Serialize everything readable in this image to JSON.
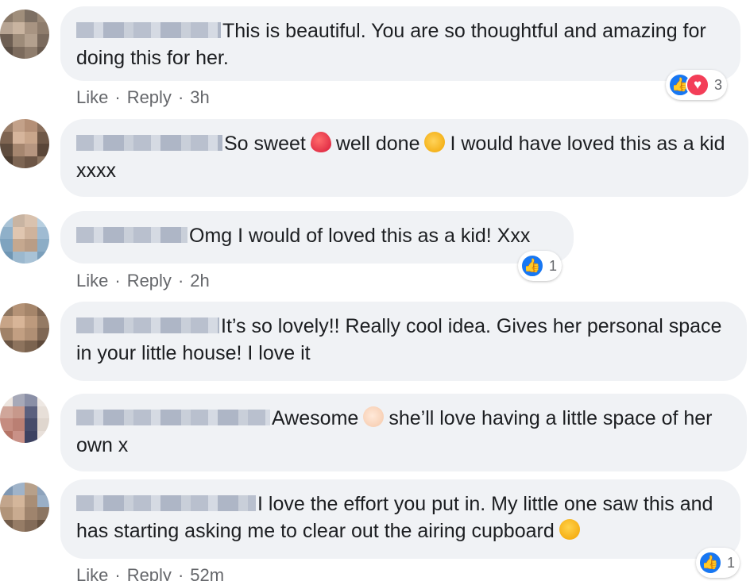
{
  "comments": [
    {
      "name_hidden": true,
      "text_parts": [
        "This is beautiful. You are so thoughtful and amazing for doing this for her."
      ],
      "actions": {
        "like": "Like",
        "reply": "Reply",
        "time": "3h"
      },
      "reactions": {
        "icons": [
          "like-icon",
          "love-icon"
        ],
        "count": "3"
      }
    },
    {
      "name_hidden": true,
      "text_parts": [
        "So sweet",
        "well done",
        "I would have loved this as a kid xxxx"
      ],
      "emojis": [
        "heart-emoji",
        "clapping-hands-emoji"
      ]
    },
    {
      "name_hidden": true,
      "text_parts": [
        "Omg I would of loved this as a kid! Xxx"
      ],
      "actions": {
        "like": "Like",
        "reply": "Reply",
        "time": "2h"
      },
      "reactions": {
        "icons": [
          "like-icon"
        ],
        "count": "1"
      }
    },
    {
      "name_hidden": true,
      "text_parts": [
        "It’s so lovely!! Really cool idea. Gives her personal space in your little house! I love it"
      ]
    },
    {
      "name_hidden": true,
      "text_parts": [
        "Awesome",
        "she’ll love having a little space of her own x"
      ],
      "emojis": [
        "clapping-hands-emoji"
      ]
    },
    {
      "name_hidden": true,
      "text_parts": [
        "I love the effort you put in. My little one saw this and has starting asking me to clear out the airing cupboard"
      ],
      "emojis": [
        "laughing-emoji"
      ],
      "actions": {
        "like": "Like",
        "reply": "Reply",
        "time": "52m"
      },
      "reactions": {
        "icons": [
          "like-icon"
        ],
        "count": "1"
      }
    }
  ],
  "separator": "·",
  "colors": {
    "bubble": "#f0f2f5",
    "meta": "#65676b",
    "like": "#1877f2",
    "love": "#f33e58"
  }
}
